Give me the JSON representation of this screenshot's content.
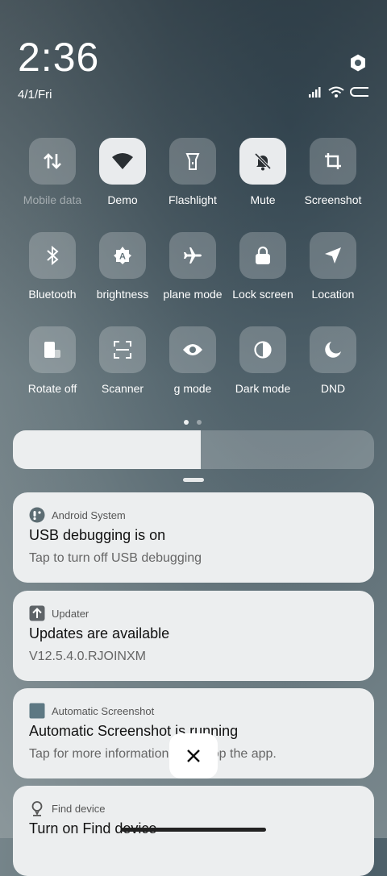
{
  "header": {
    "time": "2:36",
    "date": "4/1/Fri"
  },
  "tiles": [
    {
      "label": "Mobile data",
      "icon": "mobile-data-icon",
      "active": false,
      "disabled": true
    },
    {
      "label": "Demo",
      "icon": "wifi-icon",
      "active": true
    },
    {
      "label": "Flashlight",
      "icon": "flashlight-icon",
      "active": false
    },
    {
      "label": "Mute",
      "icon": "bell-off-icon",
      "active": true
    },
    {
      "label": "Screenshot",
      "icon": "crop-icon",
      "active": false
    },
    {
      "label": "Bluetooth",
      "icon": "bluetooth-icon",
      "active": false
    },
    {
      "label": "brightness",
      "icon": "auto-brightness-icon",
      "active": false
    },
    {
      "label": "plane mode",
      "icon": "airplane-icon",
      "active": false
    },
    {
      "label": "Lock screen",
      "icon": "lock-icon",
      "active": false
    },
    {
      "label": "Location",
      "icon": "location-arrow-icon",
      "active": false
    },
    {
      "label": "Rotate off",
      "icon": "rotate-lock-icon",
      "active": false
    },
    {
      "label": "Scanner",
      "icon": "scanner-icon",
      "active": false
    },
    {
      "label": "g mode",
      "icon": "eye-icon",
      "active": false
    },
    {
      "label": "Dark mode",
      "icon": "dark-mode-icon",
      "active": false
    },
    {
      "label": "DND",
      "icon": "moon-icon",
      "active": false
    }
  ],
  "brightness_level": 0.52,
  "pager": {
    "current_page": 1,
    "page_count": 2
  },
  "notifications": [
    {
      "app": "Android System",
      "icon": "android-system-icon",
      "title": "USB debugging is on",
      "body": "Tap to turn off USB debugging"
    },
    {
      "app": "Updater",
      "icon": "update-arrow-icon",
      "title": "Updates are available",
      "body": "V12.5.4.0.RJOINXM"
    },
    {
      "app": "Automatic Screenshot",
      "icon": "app-square-icon",
      "title": "Automatic Screenshot is running",
      "body": "Tap for more information or to stop the app."
    },
    {
      "app": "Find device",
      "icon": "find-device-icon",
      "title": "Turn on Find device",
      "body": ""
    }
  ],
  "colors": {
    "tile_active": "#e9ebed",
    "tile_inactive": "rgba(255,255,255,0.22)",
    "card_bg": "#eceeef"
  }
}
